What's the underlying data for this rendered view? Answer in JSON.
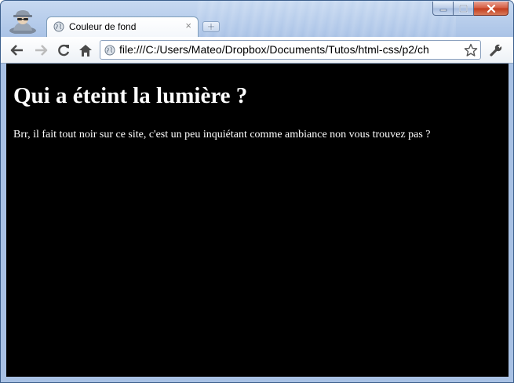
{
  "window": {
    "minimize_icon": "minimize-icon",
    "maximize_icon": "maximize-icon",
    "close_icon": "close-icon",
    "incognito_icon": "incognito-icon"
  },
  "tabs": [
    {
      "title": "Couleur de fond",
      "close_label": "×",
      "icon": "globe-icon",
      "active": true
    }
  ],
  "toolbar": {
    "back_icon": "back-arrow-icon",
    "forward_icon": "forward-arrow-icon",
    "reload_icon": "reload-icon",
    "home_icon": "home-icon",
    "wrench_icon": "wrench-icon",
    "address": "file:///C:/Users/Mateo/Dropbox/Documents/Tutos/html-css/p2/ch",
    "bookmark_icon": "star-icon"
  },
  "page": {
    "heading": "Qui a éteint la lumière ?",
    "paragraph": "Brr, il fait tout noir sur ce site, c'est un peu inquiétant comme ambiance non vous trouvez pas ?",
    "background_color": "#000000",
    "text_color": "#ffffff"
  },
  "colors": {
    "frame": "#aec6e8",
    "close_button": "#c23a1c"
  }
}
